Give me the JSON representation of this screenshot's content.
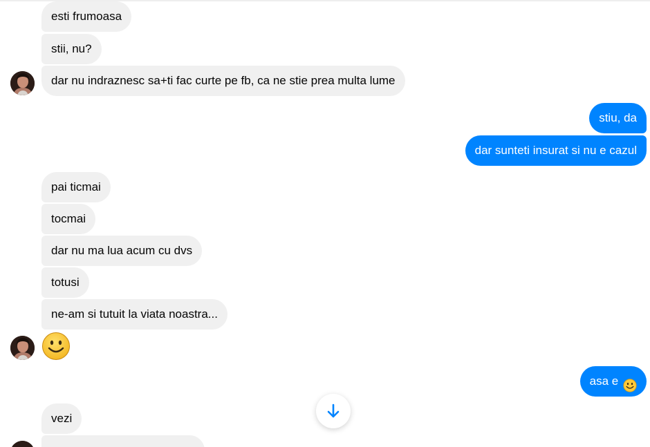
{
  "messages": {
    "m1": "esti frumoasa",
    "m2": "stii, nu?",
    "m3": "dar nu indraznesc sa+ti fac curte pe fb, ca ne stie prea multa lume",
    "m4": "stiu, da",
    "m5": "dar sunteti insurat si nu e cazul",
    "m6": "pai ticmai",
    "m7": "tocmai",
    "m8": "dar nu ma lua acum cu dvs",
    "m9": "totusi",
    "m10": "ne-am si tutuit la viata noastra...",
    "m12": "asa e",
    "m13": "vezi"
  },
  "colors": {
    "incoming_bubble": "#f0f0f0",
    "outgoing_bubble": "#0084ff",
    "accent": "#0084ff",
    "emoji_face": "#fdc93a"
  },
  "icons": {
    "big_emoji": "smiley-emoji-icon",
    "inline_emoji": "smiley-emoji-icon",
    "scroll_down": "arrow-down-icon",
    "avatar": "contact-avatar"
  }
}
